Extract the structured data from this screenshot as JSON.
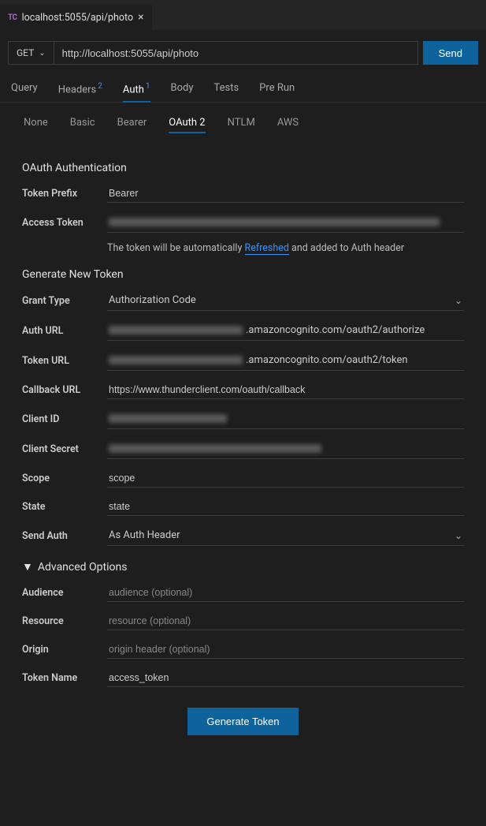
{
  "tab": {
    "icon_text": "TC",
    "title": "localhost:5055/api/photo",
    "close": "×"
  },
  "request": {
    "method": "GET",
    "url": "http://localhost:5055/api/photo",
    "send": "Send"
  },
  "req_tabs": {
    "query": "Query",
    "headers": "Headers",
    "headers_badge": "2",
    "auth": "Auth",
    "auth_badge": "1",
    "body": "Body",
    "tests": "Tests",
    "prerun": "Pre Run"
  },
  "auth_tabs": {
    "none": "None",
    "basic": "Basic",
    "bearer": "Bearer",
    "oauth2": "OAuth 2",
    "ntlm": "NTLM",
    "aws": "AWS"
  },
  "oauth": {
    "title": "OAuth Authentication",
    "token_prefix_label": "Token Prefix",
    "token_prefix": "Bearer",
    "access_token_label": "Access Token",
    "hint_pre": "The token will be automatically ",
    "hint_link": "Refreshed",
    "hint_post": " and added to Auth header"
  },
  "gen": {
    "title": "Generate New Token",
    "grant_type_label": "Grant Type",
    "grant_type": "Authorization Code",
    "auth_url_label": "Auth URL",
    "auth_url_suffix": ".amazoncognito.com/oauth2/authorize",
    "token_url_label": "Token URL",
    "token_url_suffix": ".amazoncognito.com/oauth2/token",
    "callback_label": "Callback URL",
    "callback": "https://www.thunderclient.com/oauth/callback",
    "client_id_label": "Client ID",
    "client_secret_label": "Client Secret",
    "scope_label": "Scope",
    "scope": "scope",
    "state_label": "State",
    "state": "state",
    "send_auth_label": "Send Auth",
    "send_auth": "As Auth Header"
  },
  "adv": {
    "title": "Advanced Options",
    "audience_label": "Audience",
    "audience_ph": "audience (optional)",
    "resource_label": "Resource",
    "resource_ph": "resource (optional)",
    "origin_label": "Origin",
    "origin_ph": "origin header (optional)",
    "token_name_label": "Token Name",
    "token_name": "access_token"
  },
  "generate_btn": "Generate Token"
}
